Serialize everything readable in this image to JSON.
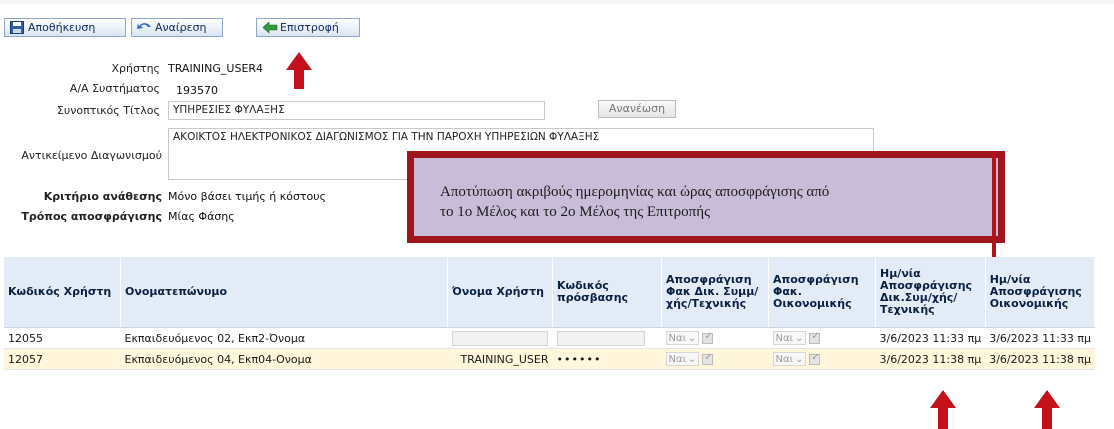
{
  "toolbar": {
    "save_label": "Αποθήκευση",
    "undo_label": "Αναίρεση",
    "back_label": "Επιστροφή"
  },
  "form": {
    "user_label": "Χρήστης",
    "user_value": "TRAINING_USER4",
    "system_id_label": "Α/Α Συστήματος",
    "system_id_value": "193570",
    "short_title_label": "Συνοπτικός Τίτλος",
    "short_title_value": "ΥΠΗΡΕΣΙΕΣ ΦΥΛΑΞΗΣ",
    "refresh_label": "Ανανέωση",
    "subject_label": "Αντικείμενο Διαγωνισμού",
    "subject_value": "ΑΚΟΙΚΤΟΣ ΗΛΕΚΤΡΟΝΙΚΟΣ ΔΙΑΓΩΝΙΣΜΟΣ ΓΙΑ ΤΗΝ ΠΑΡΟΧΗ ΥΠΗΡΕΣΙΩΝ ΦΥΛΑΞΗΣ",
    "award_label": "Κριτήριο ανάθεσης",
    "award_value": "Μόνο βάσει τιμής ή κόστους",
    "unseal_label": "Τρόπος αποσφράγισης",
    "unseal_value": "Μίας Φάσης"
  },
  "callout": {
    "line1": "Αποτύπωση ακριβούς ημερομηνίας και ώρας αποσφράγισης  από",
    "line2": "το 1ο Μέλος και το 2ο Μέλος της Επιτροπής"
  },
  "table": {
    "headers": [
      "Κωδικός Χρήστη",
      "Ονοματεπώνυμο",
      "Όνομα Χρήστη",
      "Κωδικός πρόσβασης",
      "Αποσφράγιση Φακ Δικ. Συμμ/ χής/Τεχνικής",
      "Αποσφράγιση Φακ. Οικονομικής",
      "Ημ/νία Αποσφράγισης Δικ.Συμ/χής/ Τεχνικής",
      "Ημ/νία Αποσφράγισης Οικονομικής"
    ],
    "rows": [
      {
        "code": "12055",
        "name": "Εκπαιδευόμενος 02, Εκπ2-Όνομα",
        "username": "",
        "password": "",
        "tech_select": "Ναι",
        "fin_select": "Ναι",
        "tech_date": "3/6/2023 11:33 πμ",
        "fin_date": "3/6/2023 11:33 πμ"
      },
      {
        "code": "12057",
        "name": "Εκπαιδευόμενος 04, Εκπ04-Ονομα",
        "username": "TRAINING_USER",
        "password": "••••••",
        "tech_select": "Ναι",
        "fin_select": "Ναι",
        "tech_date": "3/6/2023 11:38 πμ",
        "fin_date": "3/6/2023 11:38 πμ"
      }
    ]
  },
  "colors": {
    "annotation_red": "#c41019",
    "callout_fill": "#c8bcd9",
    "header_fill": "#e3ecf6",
    "alt_row_fill": "#fff6dc"
  }
}
